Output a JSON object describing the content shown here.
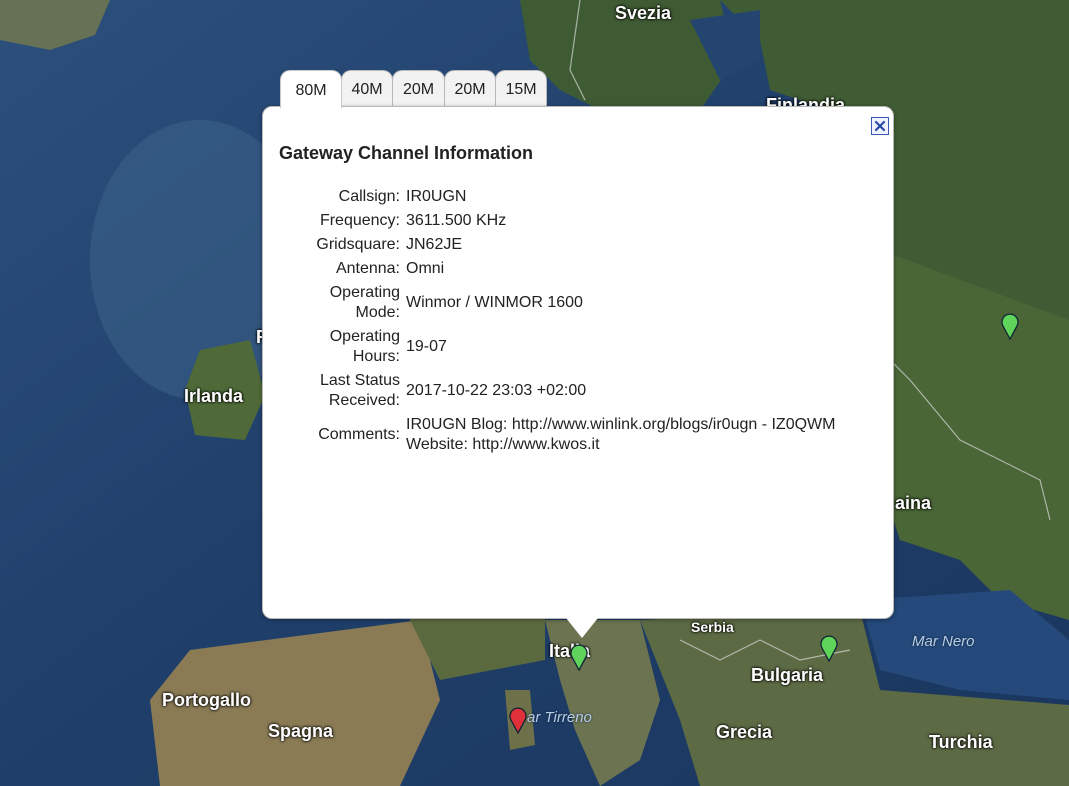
{
  "map": {
    "places": [
      {
        "id": "svezia",
        "label": "Svezia"
      },
      {
        "id": "finlandia",
        "label": "Finlandia"
      },
      {
        "id": "irlanda",
        "label": "Irlanda"
      },
      {
        "id": "portogallo",
        "label": "Portogallo"
      },
      {
        "id": "spagna",
        "label": "Spagna"
      },
      {
        "id": "italia",
        "label": "Italia"
      },
      {
        "id": "serbia",
        "label": "Serbia"
      },
      {
        "id": "bulgaria",
        "label": "Bulgaria"
      },
      {
        "id": "grecia",
        "label": "Grecia"
      },
      {
        "id": "turchia",
        "label": "Turchia"
      },
      {
        "id": "ucraina",
        "label": "aina"
      },
      {
        "id": "regno-unito",
        "label": "R"
      }
    ],
    "seas": [
      {
        "id": "mar-nero",
        "label": "Mar Nero"
      },
      {
        "id": "mar-tirreno",
        "label": "ar Tirreno"
      }
    ],
    "marker_colors": {
      "green": "#5fd35a",
      "red": "#e0303a"
    }
  },
  "infowindow": {
    "tabs": [
      "80M",
      "40M",
      "20M",
      "20M",
      "15M"
    ],
    "active_tab": "80M",
    "heading": "Gateway Channel Information",
    "fields": {
      "callsign": {
        "label": "Callsign:",
        "value": "IR0UGN"
      },
      "frequency": {
        "label": "Frequency:",
        "value": "3611.500 KHz"
      },
      "gridsquare": {
        "label": "Gridsquare:",
        "value": "JN62JE"
      },
      "antenna": {
        "label": "Antenna:",
        "value": "Omni"
      },
      "mode": {
        "label_line1": "Operating",
        "label_line2": "Mode:",
        "value": "Winmor / WINMOR 1600"
      },
      "hours": {
        "label_line1": "Operating",
        "label_line2": "Hours:",
        "value": "19-07"
      },
      "status": {
        "label_line1": "Last Status",
        "label_line2": "Received:",
        "value": "2017-10-22 23:03 +02:00"
      },
      "comments": {
        "label": "Comments:",
        "line1": "IR0UGN Blog: http://www.winlink.org/blogs/ir0ugn - IZ0QWM",
        "line2": "Website: http://www.kwos.it"
      }
    }
  }
}
